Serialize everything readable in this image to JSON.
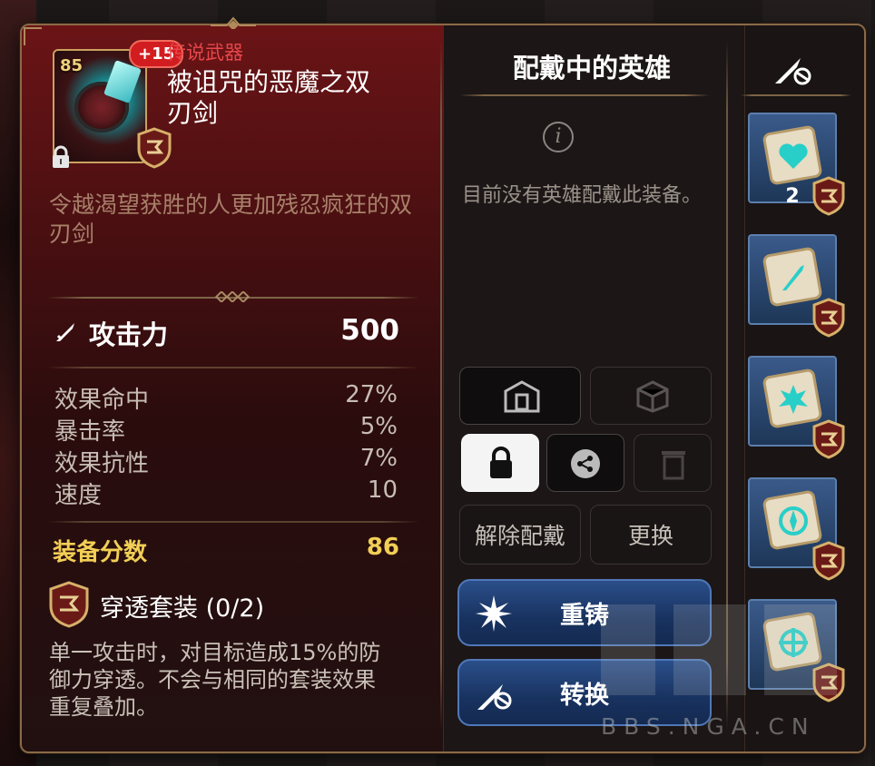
{
  "item": {
    "level": "85",
    "enhance": "+15",
    "rarity": "传说武器",
    "name": "被诅咒的恶魔之双刃剑",
    "description": "令越渴望获胜的人更加残忍疯狂的双刃剑"
  },
  "main_stat": {
    "label": "攻击力",
    "value": "500"
  },
  "substats": [
    {
      "label": "效果命中",
      "value": "27%"
    },
    {
      "label": "暴击率",
      "value": "5%"
    },
    {
      "label": "效果抗性",
      "value": "7%"
    },
    {
      "label": "速度",
      "value": "10"
    }
  ],
  "gear_score": {
    "label": "装备分数",
    "value": "86"
  },
  "set": {
    "title": "穿透套装 (0/2)",
    "description": "单一攻击时，对目标造成15%的防御力穿透。不会与相同的套装效果重复叠加。"
  },
  "equipped": {
    "title": "配戴中的英雄",
    "empty_message": "目前没有英雄配戴此装备。"
  },
  "buttons": {
    "unequip": "解除配戴",
    "change": "更换",
    "reforge": "重铸",
    "convert": "转换"
  },
  "right_panel": {
    "slot_count": "2"
  },
  "watermark": "BBS.NGA.CN",
  "colors": {
    "rarity": "#e8464a",
    "gear_score": "#f2cf55",
    "blue_button": "#18325f"
  }
}
